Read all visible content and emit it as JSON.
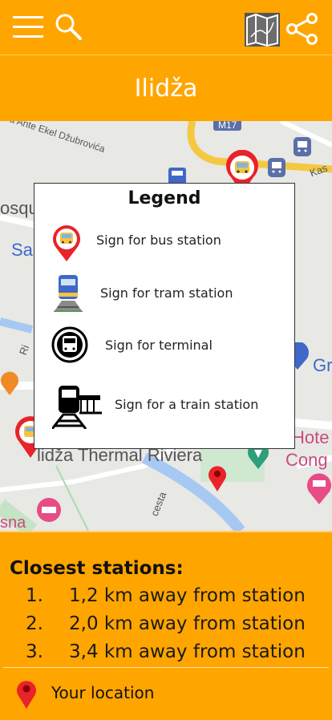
{
  "header": {
    "menu_icon": "hamburger-menu-icon",
    "search_icon": "search-icon",
    "map_icon": "map-icon",
    "share_icon": "share-icon"
  },
  "page": {
    "title": "Ilidža"
  },
  "map": {
    "labels": [
      "Ulica Ante Ekel Džubrovića",
      "M17",
      "Kas",
      "osqu",
      "Sa",
      "Ri",
      "Gr",
      "Hote",
      "Cong",
      "lidža Thermal Riviera",
      "cesta",
      "sna"
    ]
  },
  "legend": {
    "title": "Legend",
    "items": [
      {
        "icon": "bus-station-pin-icon",
        "label": "Sign for bus station"
      },
      {
        "icon": "tram-icon",
        "label": "Sign for tram station"
      },
      {
        "icon": "terminal-icon",
        "label": "Sign for terminal"
      },
      {
        "icon": "train-icon",
        "label": "Sign for a train station"
      }
    ]
  },
  "closest": {
    "title": "Closest stations:",
    "stations": [
      {
        "num": "1.",
        "text": "1,2 km away from station"
      },
      {
        "num": "2.",
        "text": "2,0 km away from station"
      },
      {
        "num": "3.",
        "text": "3,4 km away from station"
      }
    ]
  },
  "location": {
    "icon": "location-pin-icon",
    "label": "Your location"
  },
  "colors": {
    "accent": "#FFA500",
    "pin_red": "#E8232A"
  }
}
